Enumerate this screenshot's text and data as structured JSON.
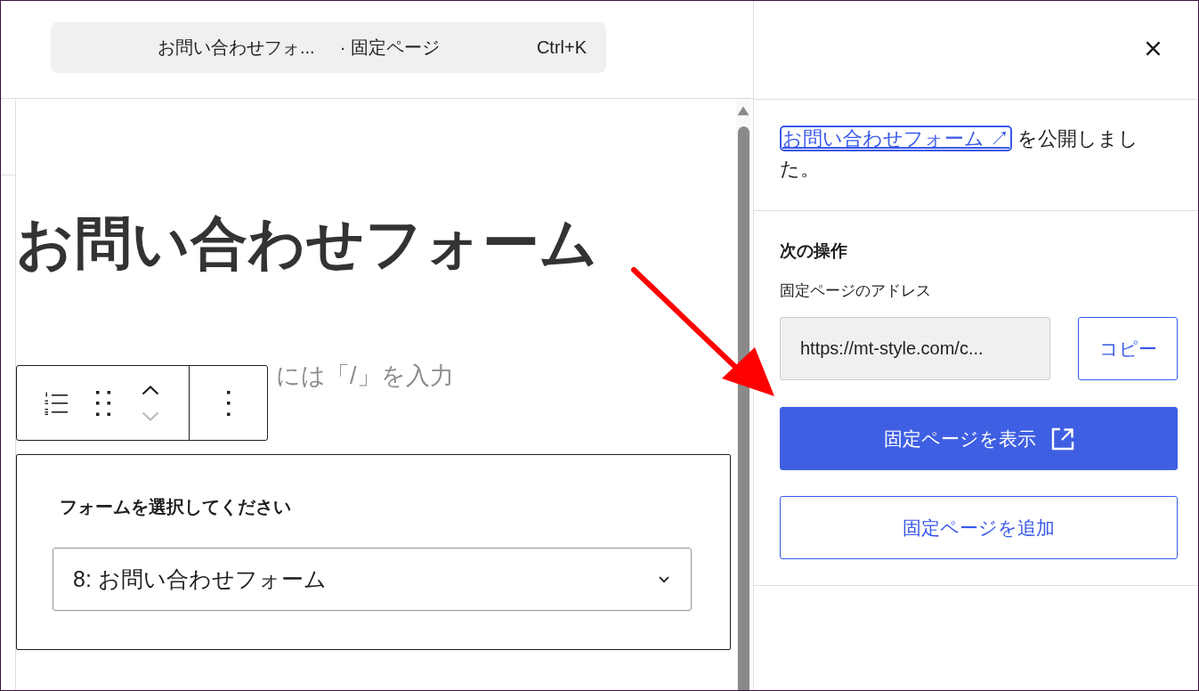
{
  "editor_header": {
    "command_bar": {
      "title": "お問い合わせフォ...",
      "type": "· 固定ページ",
      "shortcut": "Ctrl+K"
    }
  },
  "editor": {
    "title": "お問い合わせフォーム",
    "hint_text": "には「/」を入力",
    "block_toolbar": {
      "move_up": {
        "disabled": false
      },
      "move_down": {
        "disabled": true
      }
    },
    "form_block": {
      "label": "フォームを選択してください",
      "select": {
        "value": "8: お問い合わせフォーム"
      }
    }
  },
  "post_publish_panel": {
    "notice": {
      "link": "お問い合わせフォーム ↗",
      "text": "を公開しました。"
    },
    "next_steps": {
      "heading": "次の操作",
      "address_label": "固定ページのアドレス",
      "address_value": "https://mt-style.com/c...",
      "copy_button": "コピー",
      "buttons": [
        {
          "label": "固定ページを表示",
          "kind": "primary",
          "external": true
        },
        {
          "label": "固定ページを追加",
          "kind": "secondary",
          "external": false
        }
      ]
    }
  }
}
